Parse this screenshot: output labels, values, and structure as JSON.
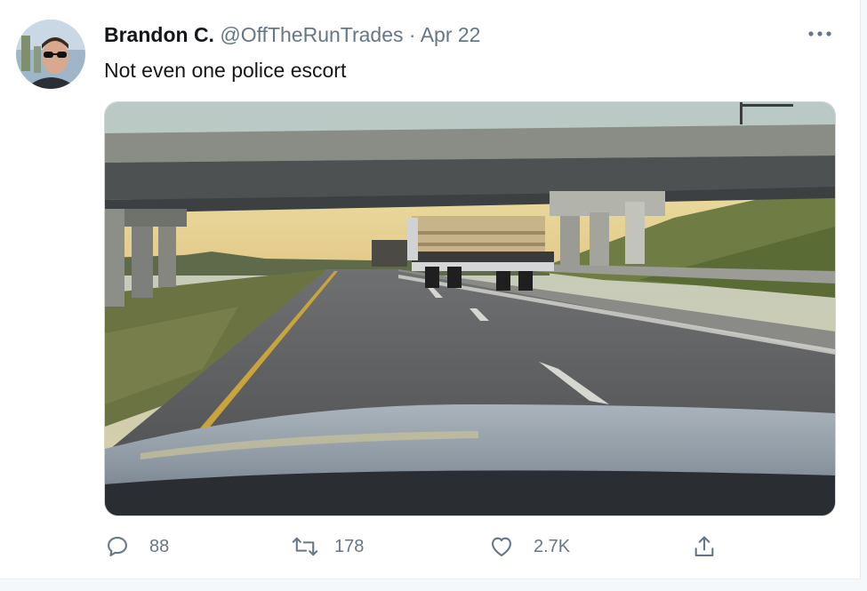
{
  "tweet": {
    "display_name": "Brandon C.",
    "handle": "@OffTheRunTrades",
    "separator": "·",
    "date": "Apr 22",
    "text": "Not even one police escort"
  },
  "icons": {
    "more": "more-horizontal-icon",
    "reply": "reply-icon",
    "retweet": "retweet-icon",
    "like": "heart-icon",
    "share": "share-icon"
  },
  "actions": {
    "replies": "88",
    "retweets": "178",
    "likes": "2.7K"
  },
  "colors": {
    "text_primary": "#14171a",
    "text_secondary": "#657786",
    "border": "#ccd6dd"
  }
}
